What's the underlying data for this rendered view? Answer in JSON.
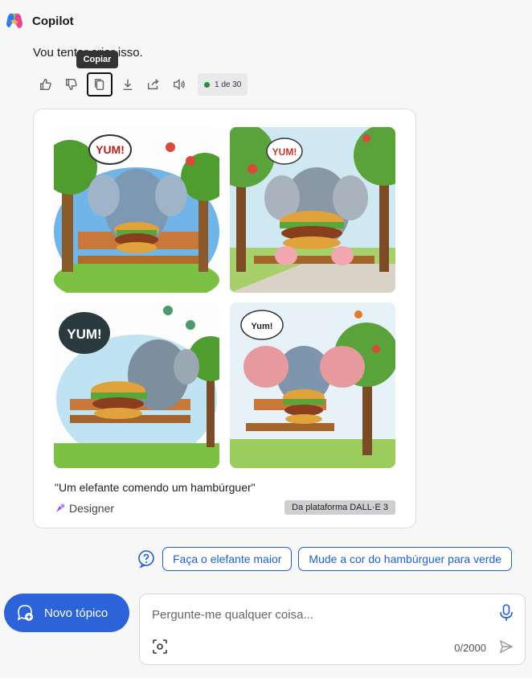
{
  "header": {
    "app_name": "Copilot"
  },
  "message": {
    "text": "Vou tentar criar isso."
  },
  "tooltip": {
    "label": "Copiar"
  },
  "actions": {
    "icons": [
      "thumbs-up-icon",
      "thumbs-down-icon",
      "copy-icon",
      "download-icon",
      "share-icon",
      "speaker-icon"
    ],
    "counter": "1 de 30"
  },
  "image_card": {
    "caption": "\"Um elefante comendo um hambúrguer\"",
    "source": "Designer",
    "badge": "Da plataforma DALL·E 3",
    "tiles": [
      {
        "speech": "YUM!"
      },
      {
        "speech": "YUM!"
      },
      {
        "speech": "YUM!"
      },
      {
        "speech": "Yum!"
      }
    ]
  },
  "suggestions": [
    "Faça o elefante maior",
    "Mude a cor do hambúrguer para verde"
  ],
  "new_topic": {
    "label": "Novo tópico"
  },
  "composer": {
    "placeholder": "Pergunte-me qualquer coisa...",
    "char_count": "0/2000"
  },
  "colors": {
    "accent": "#2d63d8",
    "chip": "#1f5fd1"
  }
}
